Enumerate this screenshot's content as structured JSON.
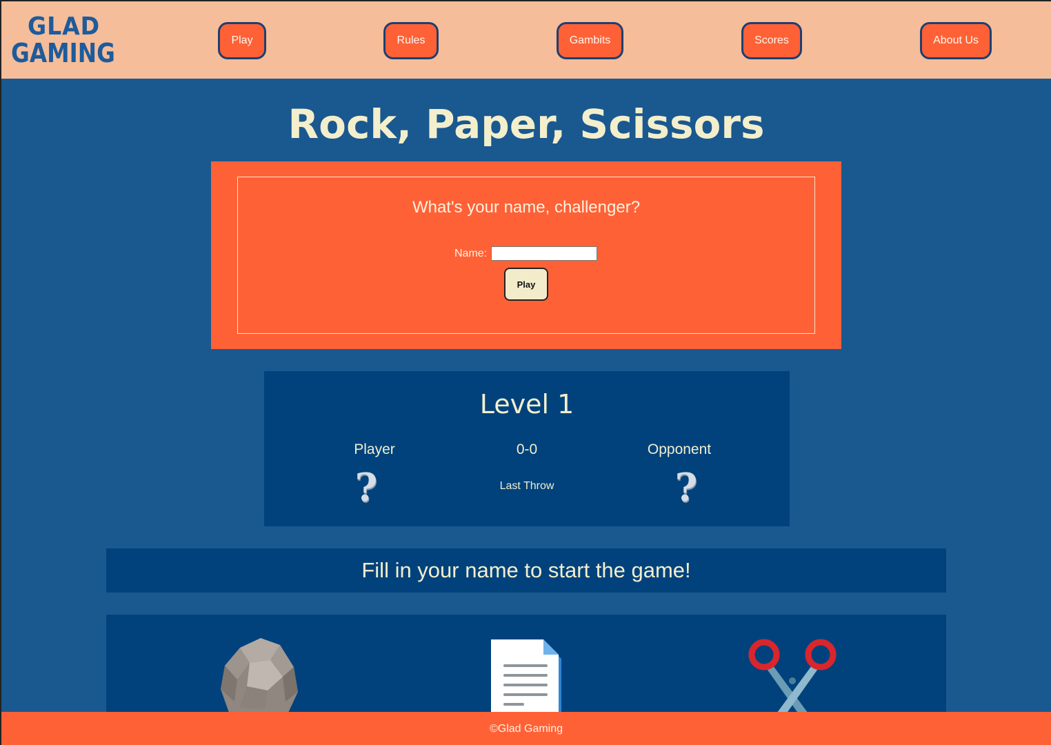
{
  "header": {
    "logo": {
      "line1": "GLAD",
      "line2": "GAMING"
    },
    "nav": [
      {
        "label": "Play"
      },
      {
        "label": "Rules"
      },
      {
        "label": "Gambits"
      },
      {
        "label": "Scores"
      },
      {
        "label": "About Us"
      }
    ]
  },
  "main": {
    "title": "Rock, Paper, Scissors",
    "name_form": {
      "question": "What's your name, challenger?",
      "name_label": "Name:",
      "name_value": "",
      "play_label": "Play"
    },
    "level": {
      "title": "Level 1",
      "player_label": "Player",
      "score": "0-0",
      "opponent_label": "Opponent",
      "last_throw_label": "Last Throw",
      "player_throw": "?",
      "opponent_throw": "?"
    },
    "status": "Fill in your name to start the game!",
    "choices": [
      {
        "icon": "rock-icon"
      },
      {
        "icon": "paper-icon"
      },
      {
        "icon": "scissors-icon"
      }
    ]
  },
  "footer": {
    "text": "©Glad Gaming"
  },
  "colors": {
    "background": "#1a5890",
    "header": "#f5bd99",
    "accent": "#ff6137",
    "panel": "#01427d",
    "text_cream": "#f3efcc"
  }
}
